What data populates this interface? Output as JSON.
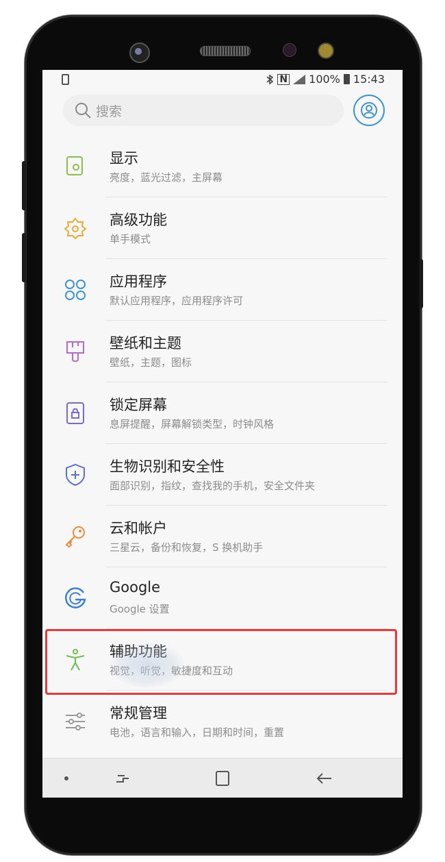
{
  "statusbar": {
    "nfc": "N",
    "battery": "100%",
    "time": "15:43"
  },
  "search": {
    "placeholder": "搜索"
  },
  "menu": [
    {
      "title": "显示",
      "subtitle": "亮度，蓝光过滤，主屏幕",
      "icon": "display-icon",
      "color": "#8bbf4a"
    },
    {
      "title": "高级功能",
      "subtitle": "单手模式",
      "icon": "advanced-features-icon",
      "color": "#f0a830"
    },
    {
      "title": "应用程序",
      "subtitle": "默认应用程序，应用程序许可",
      "icon": "apps-icon",
      "color": "#3b93d6"
    },
    {
      "title": "壁纸和主题",
      "subtitle": "壁纸，主题，图标",
      "icon": "wallpaper-brush-icon",
      "color": "#b36ad1"
    },
    {
      "title": "锁定屏幕",
      "subtitle": "息屏提醒，屏幕解锁类型，时钟风格",
      "icon": "lock-screen-icon",
      "color": "#7b6ad1"
    },
    {
      "title": "生物识别和安全性",
      "subtitle": "面部识别，指纹，查找我的手机，安全文件夹",
      "icon": "shield-icon",
      "color": "#5a6fd1"
    },
    {
      "title": "云和帐户",
      "subtitle": "三星云，备份和恢复，S 换机助手",
      "icon": "key-icon",
      "color": "#f08a3a"
    },
    {
      "title": "Google",
      "subtitle": "Google 设置",
      "icon": "google-icon",
      "color": "#3b7fd6"
    },
    {
      "title": "辅助功能",
      "subtitle": "视觉，听觉，敏捷度和互动",
      "icon": "accessibility-icon",
      "color": "#6bbf4a"
    },
    {
      "title": "常规管理",
      "subtitle": "电池，语言和输入，日期和时间，重置",
      "icon": "sliders-icon",
      "color": "#9a9a9a"
    }
  ],
  "colors": {
    "highlight": "#e53a3a",
    "accent": "#3b93d6"
  }
}
